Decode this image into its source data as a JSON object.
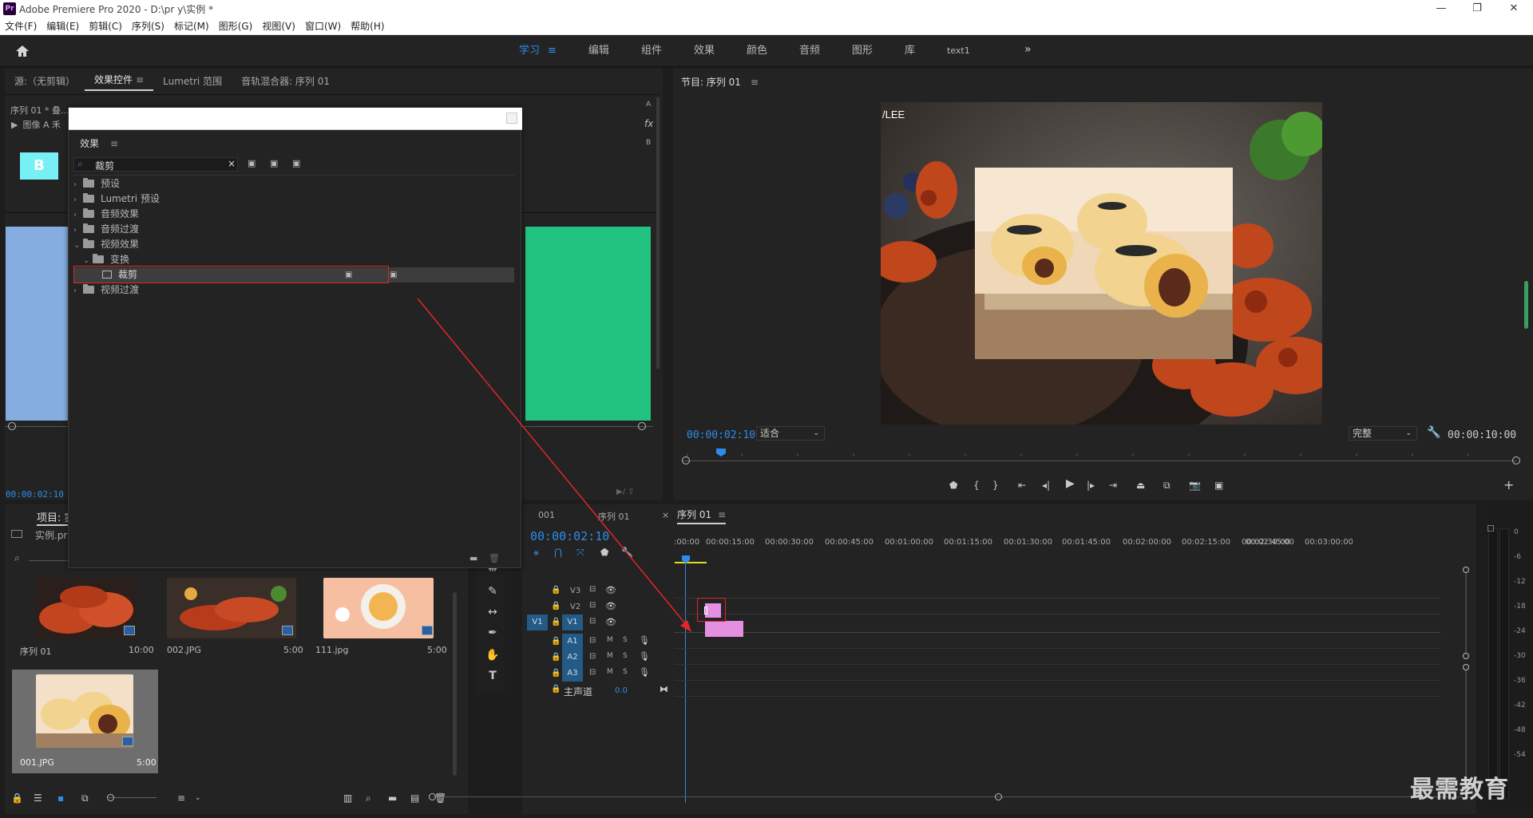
{
  "app": {
    "title": "Adobe Premiere Pro 2020 - D:\\pr y\\实例 *",
    "logo": "Pr"
  },
  "menu": [
    "文件(F)",
    "编辑(E)",
    "剪辑(C)",
    "序列(S)",
    "标记(M)",
    "图形(G)",
    "视图(V)",
    "窗口(W)",
    "帮助(H)"
  ],
  "workspaces": [
    "学习",
    "编辑",
    "组件",
    "效果",
    "颜色",
    "音频",
    "图形",
    "库",
    "text1"
  ],
  "active_workspace": "学习",
  "source_panel": {
    "tabs": [
      "源:（无剪辑）",
      "效果控件",
      "Lumetri 范围",
      "音轨混合器: 序列 01"
    ],
    "seq_label": "序列 01 * 叠...",
    "image_row": "图像 A 禾",
    "timecode": "00:00:02:10",
    "side_letters": [
      "A",
      "fx",
      "B"
    ],
    "b_label": "B"
  },
  "effects_window": {
    "title": "效果",
    "search_value": "裁剪",
    "tree": [
      {
        "label": "预设",
        "level": 0,
        "expanded": false
      },
      {
        "label": "Lumetri 预设",
        "level": 0,
        "expanded": false
      },
      {
        "label": "音频效果",
        "level": 0,
        "expanded": false
      },
      {
        "label": "音频过渡",
        "level": 0,
        "expanded": false
      },
      {
        "label": "视频效果",
        "level": 0,
        "expanded": true
      },
      {
        "label": "变换",
        "level": 1,
        "expanded": true
      },
      {
        "label": "裁剪",
        "level": 2,
        "selected": true
      },
      {
        "label": "视频过渡",
        "level": 0,
        "expanded": false
      }
    ]
  },
  "program_monitor": {
    "title": "节目: 序列 01",
    "timecode": "00:00:02:10",
    "fit": "适合",
    "quality": "完整",
    "duration": "00:00:10:00",
    "overlay_text": "/LEE"
  },
  "project_panel": {
    "tab": "项目: 实",
    "file": "实例.prproj",
    "items": [
      {
        "name": "序列 01",
        "duration": "10:00"
      },
      {
        "name": "002.JPG",
        "duration": "5:00"
      },
      {
        "name": "111.jpg",
        "duration": "5:00"
      },
      {
        "name": "001.JPG",
        "duration": "5:00"
      }
    ]
  },
  "timeline": {
    "tabs": [
      "001",
      "序列 01",
      "序列 01"
    ],
    "timecode": "00:00:02:10",
    "ruler": [
      ":00:00",
      "00:00:15:00",
      "00:00:30:00",
      "00:00:45:00",
      "00:01:00:00",
      "00:01:15:00",
      "00:01:30:00",
      "00:01:45:00",
      "00:02:00:00",
      "00:02:15:00",
      "00:02:30:00",
      "00:02:45:00",
      "00:03:00:00"
    ],
    "video_tracks": [
      "V3",
      "V2",
      "V1"
    ],
    "audio_tracks": [
      "A1",
      "A2",
      "A3"
    ],
    "source_patch": "V1",
    "master": "主声道",
    "master_value": "0.0",
    "track_buttons": [
      "M",
      "S"
    ]
  },
  "meter_scale": [
    "0",
    "-6",
    "-12",
    "-18",
    "-24",
    "-30",
    "-36",
    "-42",
    "-48",
    "-54"
  ],
  "watermark": "最需教育",
  "colors": {
    "accent": "#2d8ceb",
    "clip": "#e58fe0",
    "highlight_box": "#e0262b",
    "panel": "#232323",
    "bg": "#1d1d1d"
  }
}
